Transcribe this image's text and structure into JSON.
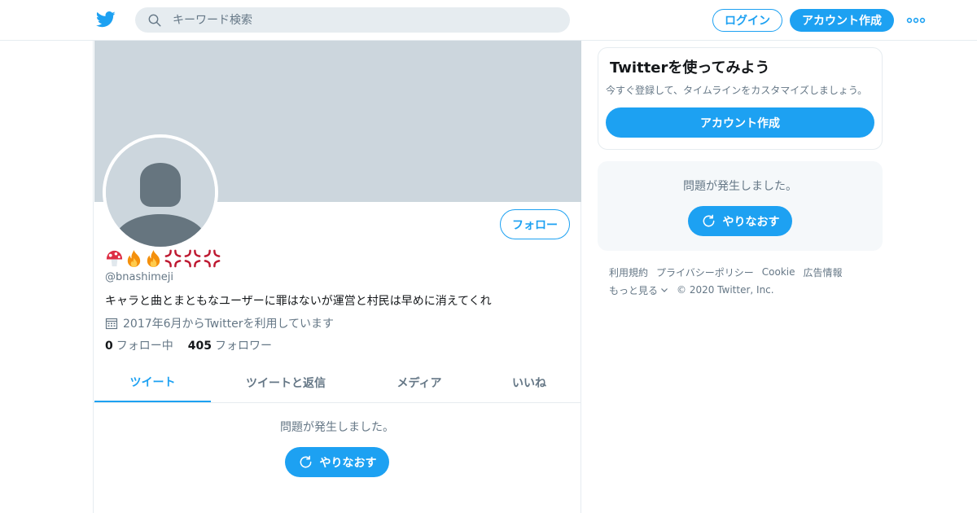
{
  "header": {
    "search_placeholder": "キーワード検索",
    "login_label": "ログイン",
    "signup_label": "アカウント作成",
    "more_icon": "more-dots-icon"
  },
  "profile": {
    "display_name_emojis": [
      "mushroom",
      "fire",
      "fire",
      "anger",
      "anger",
      "anger"
    ],
    "follow_label": "フォロー",
    "handle": "@bnashimeji",
    "bio": "キャラと曲とまともなユーザーに罪はないが運営と村民は早めに消えてくれ",
    "joined": "2017年6月からTwitterを利用しています",
    "following_count": "0",
    "following_label": "フォロー中",
    "followers_count": "405",
    "followers_label": "フォロワー"
  },
  "tabs": [
    {
      "label": "ツイート",
      "active": true
    },
    {
      "label": "ツイートと返信",
      "active": false
    },
    {
      "label": "メディア",
      "active": false
    },
    {
      "label": "いいね",
      "active": false
    }
  ],
  "timeline": {
    "error": "問題が発生しました。",
    "retry_label": "やりなおす"
  },
  "sidebar": {
    "signup_title": "Twitterを使ってみよう",
    "signup_sub": "今すぐ登録して、タイムラインをカスタマイズしましょう。",
    "signup_button": "アカウント作成",
    "error": "問題が発生しました。",
    "retry_label": "やりなおす"
  },
  "footer": {
    "links": [
      "利用規約",
      "プライバシーポリシー",
      "Cookie",
      "広告情報"
    ],
    "more": "もっと見る",
    "copyright": "© 2020 Twitter, Inc."
  },
  "colors": {
    "accent": "#1da1f2",
    "banner": "#ccd6dd",
    "muted_text": "#657786"
  }
}
